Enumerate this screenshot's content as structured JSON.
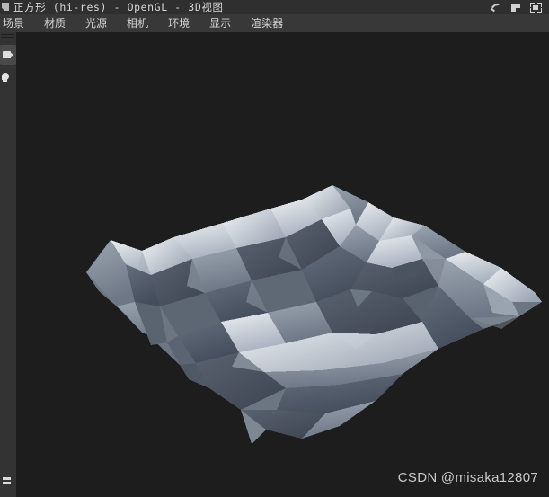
{
  "window": {
    "title": "正方形 (hi-res) - OpenGL - 3D视图",
    "icon": "document-icon",
    "buttons": [
      {
        "name": "pin-button",
        "label": "固定"
      },
      {
        "name": "restore-button",
        "label": "还原"
      },
      {
        "name": "dock-button",
        "label": "停靠"
      }
    ]
  },
  "menubar": {
    "items": [
      {
        "label": "场景"
      },
      {
        "label": "材质"
      },
      {
        "label": "光源"
      },
      {
        "label": "相机"
      },
      {
        "label": "环境"
      },
      {
        "label": "显示"
      },
      {
        "label": "渲染器"
      }
    ]
  },
  "sidebar": {
    "tools": [
      {
        "name": "camera-tool",
        "icon": "camera-icon",
        "label": "相机",
        "active": true
      },
      {
        "name": "light-tool",
        "icon": "light-icon",
        "label": "光源",
        "active": false
      },
      {
        "name": "list-tool",
        "icon": "list-icon",
        "label": "列表",
        "active": false
      }
    ]
  },
  "viewport": {
    "name": "opengl-3d-viewport",
    "background_color": "#1d1d1d",
    "model": {
      "name": "低多边形地形网格",
      "shading": "flat-faceted",
      "base_color": "#7d8794",
      "highlight_color": "#e6e9ee",
      "shadow_color": "#434d5c"
    }
  },
  "watermark": {
    "text": "CSDN @misaka12807"
  }
}
